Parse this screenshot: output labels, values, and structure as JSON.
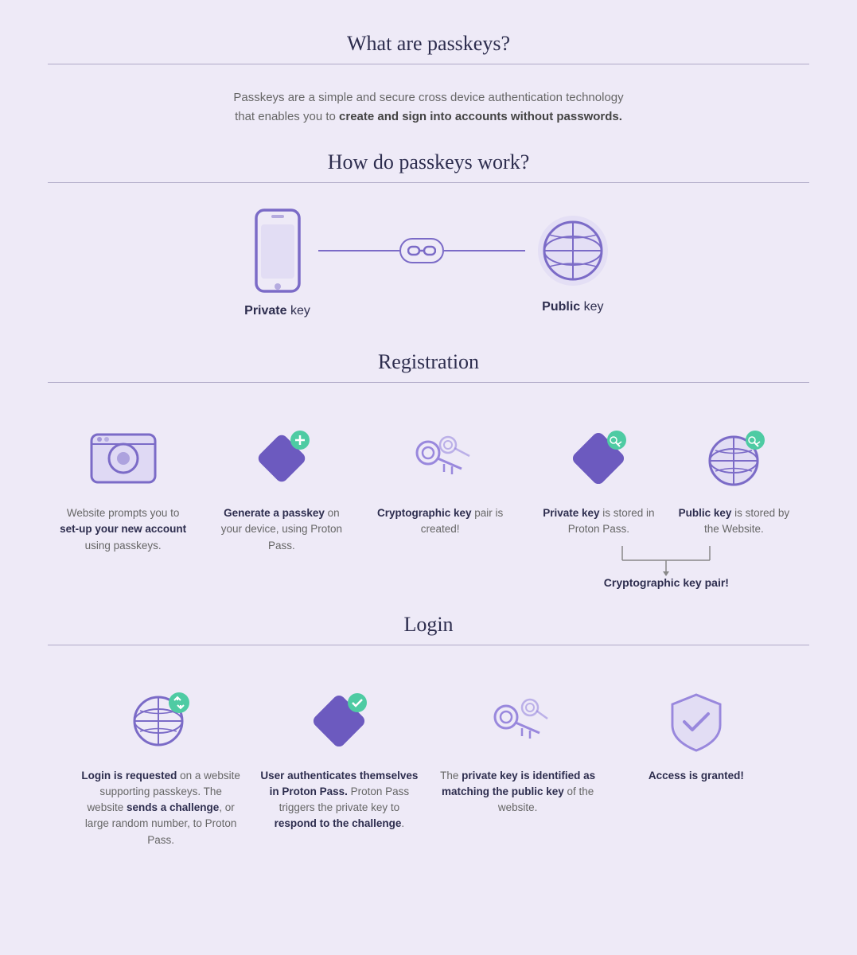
{
  "page": {
    "main_title": "What are passkeys?",
    "intro_text_plain": "Passkeys are a simple and secure cross device authentication technology that enables you to ",
    "intro_text_bold": "create and sign into accounts without passwords.",
    "how_title": "How do passkeys work?",
    "private_key_label_bold": "Private",
    "private_key_label_rest": " key",
    "public_key_label_bold": "Public",
    "public_key_label_rest": " key",
    "registration_title": "Registration",
    "login_title": "Login",
    "reg_steps": [
      {
        "text_plain": "Website prompts you to ",
        "text_bold": "set-up your new account",
        "text_after": " using passkeys."
      },
      {
        "text_bold": "Generate a passkey",
        "text_after": " on your device, using Proton Pass."
      },
      {
        "text_bold": "Cryptographic key",
        "text_after": " pair is created!"
      },
      {
        "text_bold": "Private key",
        "text_after": " is stored in Proton Pass."
      },
      {
        "text_bold": "Public key",
        "text_after": " is stored by the Website."
      }
    ],
    "key_pair_label": "Cryptographic key pair!",
    "login_steps": [
      {
        "text_bold_prefix": "Login is requested",
        "text_after": " on a website supporting passkeys. The website ",
        "text_bold2": "sends a challenge",
        "text_after2": ", or large random number, to Proton Pass."
      },
      {
        "text_bold": "User authenticates themselves in Proton Pass.",
        "text_after": " Proton Pass triggers the private key to ",
        "text_bold2": "respond to the challenge",
        "text_after2": "."
      },
      {
        "text_plain": "The ",
        "text_bold": "private key is identified as matching the public key",
        "text_after": " of the website."
      },
      {
        "text_bold": "Access is granted!"
      }
    ]
  }
}
